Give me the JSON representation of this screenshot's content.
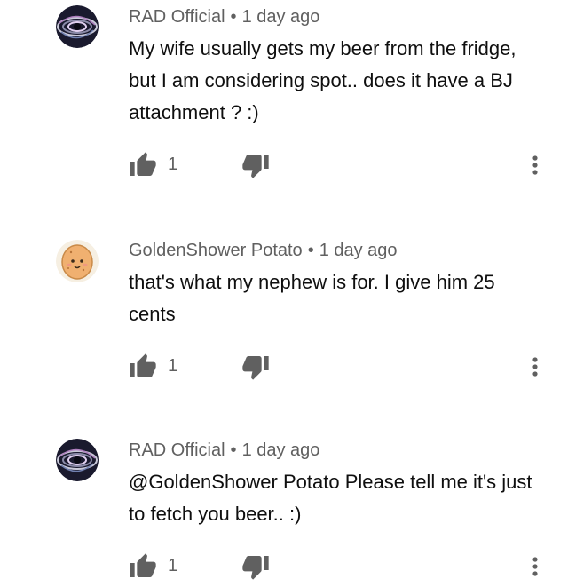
{
  "comments": [
    {
      "author": "RAD Official",
      "separator": "•",
      "time": "1 day ago",
      "text": "My wife usually gets my beer from the fridge, but I am considering spot.. does it have a BJ attachment ?  :)",
      "likes": "1",
      "avatar_icon": "spiral-vortex-avatar",
      "like_icon": "thumbs-up-icon",
      "dislike_icon": "thumbs-down-icon",
      "more_icon": "more-vert-icon"
    },
    {
      "author": "GoldenShower Potato",
      "separator": "•",
      "time": "1 day ago",
      "text": "that's what my nephew is for.  I give him 25 cents",
      "likes": "1",
      "avatar_icon": "potato-avatar",
      "like_icon": "thumbs-up-icon",
      "dislike_icon": "thumbs-down-icon",
      "more_icon": "more-vert-icon"
    },
    {
      "author": "RAD Official",
      "separator": "•",
      "time": "1 day ago",
      "text": "@GoldenShower Potato Please tell me it's just to fetch you beer.. :)",
      "likes": "1",
      "avatar_icon": "spiral-vortex-avatar",
      "like_icon": "thumbs-up-icon",
      "dislike_icon": "thumbs-down-icon",
      "more_icon": "more-vert-icon"
    }
  ],
  "colors": {
    "meta_text": "#606060",
    "body_text": "#0f0f0f",
    "icon": "#606060"
  }
}
